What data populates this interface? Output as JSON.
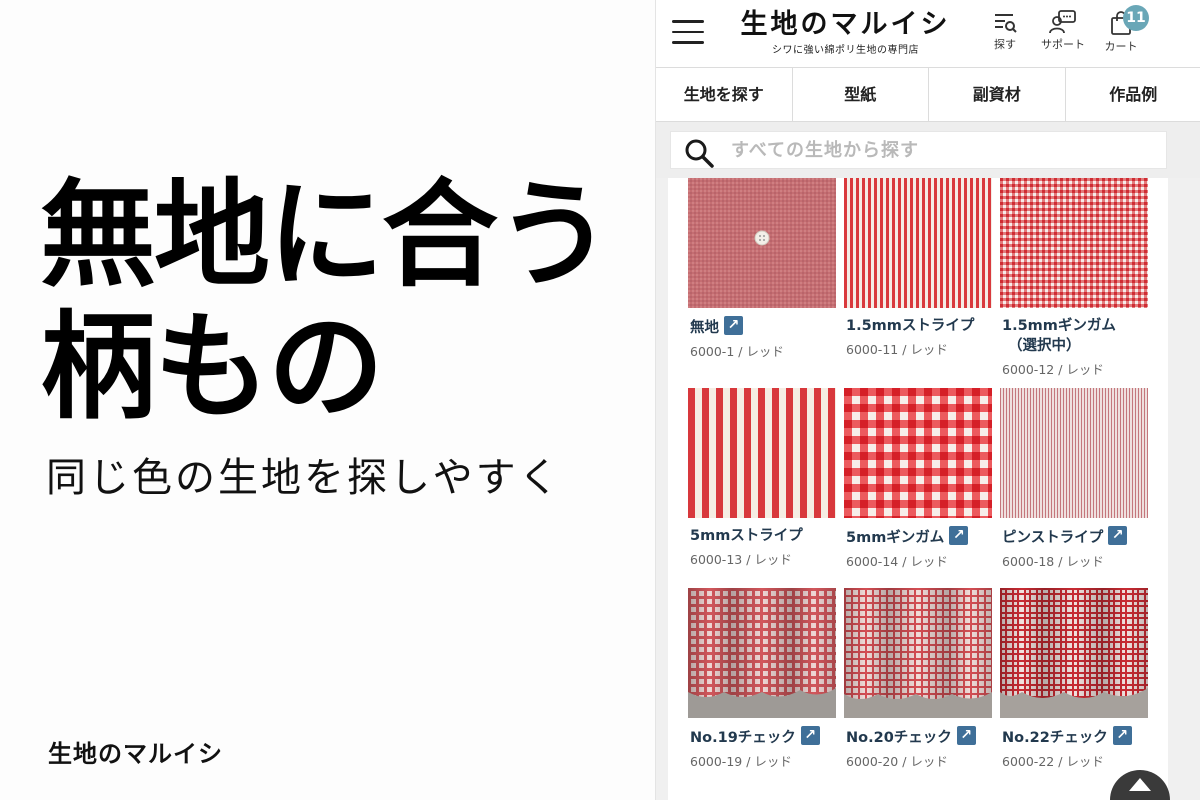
{
  "promo": {
    "headline_line1": "無地に合う",
    "headline_line2": "柄もの",
    "subtitle": "同じ色の生地を探しやすく",
    "brand": "生地のマルイシ"
  },
  "header": {
    "logo_title": "生地のマルイシ",
    "logo_tagline": "シワに強い綿ポリ生地の専門店",
    "search_label": "探す",
    "support_label": "サポート",
    "cart_label": "カート",
    "cart_count": "11",
    "badge_color": "#6aa7b7"
  },
  "nav": {
    "items": [
      "生地を探す",
      "型紙",
      "副資材",
      "作品例"
    ]
  },
  "search": {
    "placeholder": "すべての生地から探す",
    "icon": "search-icon"
  },
  "products": [
    {
      "name": "無地",
      "code": "6000-1 / レッド",
      "link_icon": true
    },
    {
      "name": "1.5mmストライプ",
      "code": "6000-11 / レッド",
      "link_icon": false
    },
    {
      "name": "1.5mmギンガム",
      "name2": "（選択中）",
      "code": "6000-12 / レッド",
      "link_icon": false
    },
    {
      "name": "5mmストライプ",
      "code": "6000-13 / レッド",
      "link_icon": false
    },
    {
      "name": "5mmギンガム",
      "code": "6000-14 / レッド",
      "link_icon": true
    },
    {
      "name": "ピンストライプ",
      "code": "6000-18 / レッド",
      "link_icon": true
    },
    {
      "name": "No.19チェック",
      "code": "6000-19 / レッド",
      "link_icon": true
    },
    {
      "name": "No.20チェック",
      "code": "6000-20 / レッド",
      "link_icon": true
    },
    {
      "name": "No.22チェック",
      "code": "6000-22 / レッド",
      "link_icon": true
    }
  ],
  "colors": {
    "accent_link": "#3f6f98",
    "product_name": "#22394e",
    "fabric_red": "#d9393d"
  }
}
